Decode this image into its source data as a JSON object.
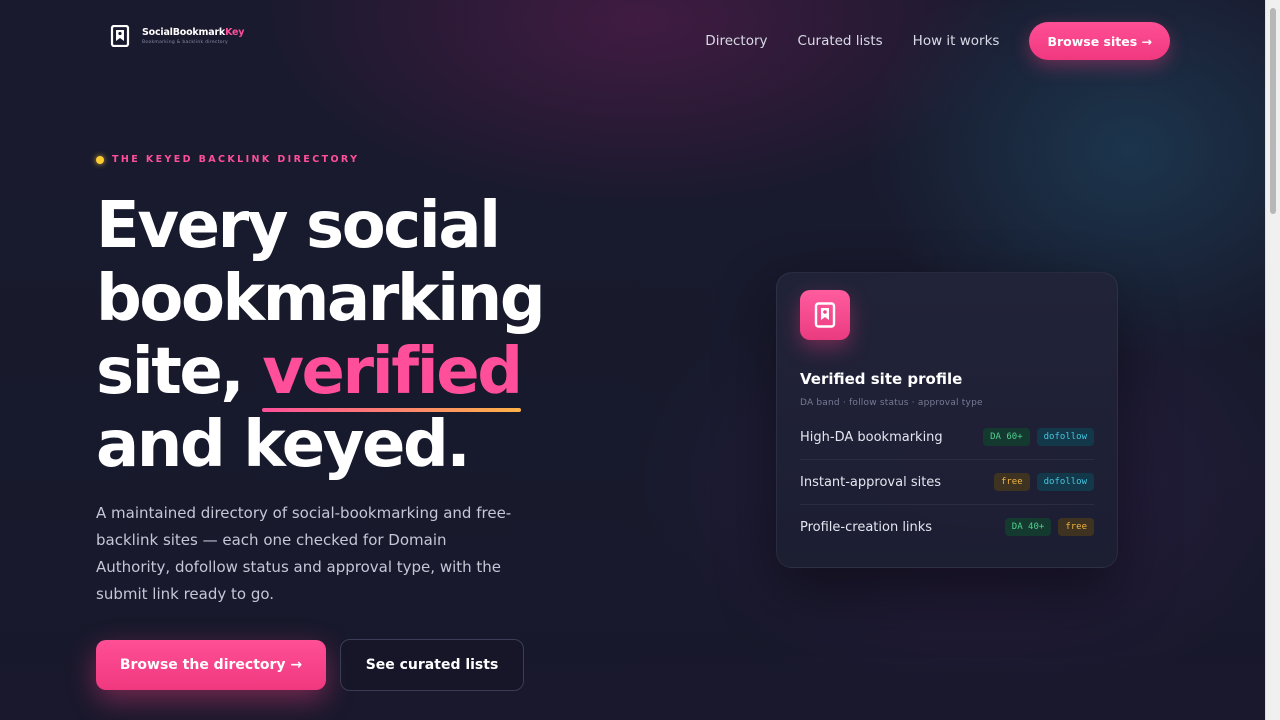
{
  "nav": {
    "brand": {
      "name": "SocialBookmark",
      "name_accent": "Key",
      "tagline": "Bookmarking & backlink directory"
    },
    "links": [
      "Directory",
      "Curated lists",
      "How it works"
    ],
    "cta_label": "Browse sites →"
  },
  "hero": {
    "eyebrow": "THE KEYED BACKLINK DIRECTORY",
    "headline": {
      "line1": "Every social",
      "line2": "bookmarking",
      "line3_prefix": "site, ",
      "line3_highlight": "verified",
      "line4": "and keyed."
    },
    "subcopy": "A maintained directory of social-bookmarking and free-backlink sites — each one checked for Domain Authority, dofollow status and approval type, with the submit link ready to go.",
    "primary_button": "Browse the directory →",
    "secondary_button": "See curated lists"
  },
  "card": {
    "title": "Verified site profile",
    "meta": "DA band · follow status · approval type",
    "rows": [
      {
        "label": "High-DA bookmarking",
        "badges": [
          {
            "text": "DA 60+",
            "tone": "green"
          },
          {
            "text": "dofollow",
            "tone": "cyan"
          }
        ]
      },
      {
        "label": "Instant-approval sites",
        "badges": [
          {
            "text": "free",
            "tone": "amber"
          },
          {
            "text": "dofollow",
            "tone": "cyan"
          }
        ]
      },
      {
        "label": "Profile-creation links",
        "badges": [
          {
            "text": "DA 40+",
            "tone": "green"
          },
          {
            "text": "free",
            "tone": "amber"
          }
        ]
      }
    ]
  },
  "colors": {
    "accent": "#ff4f9a",
    "background": "#1a1a2e",
    "eyebrow_dot": "#ffcc33"
  },
  "icons": {
    "brand": "bookmark-key-icon",
    "card": "bookmark-icon"
  }
}
